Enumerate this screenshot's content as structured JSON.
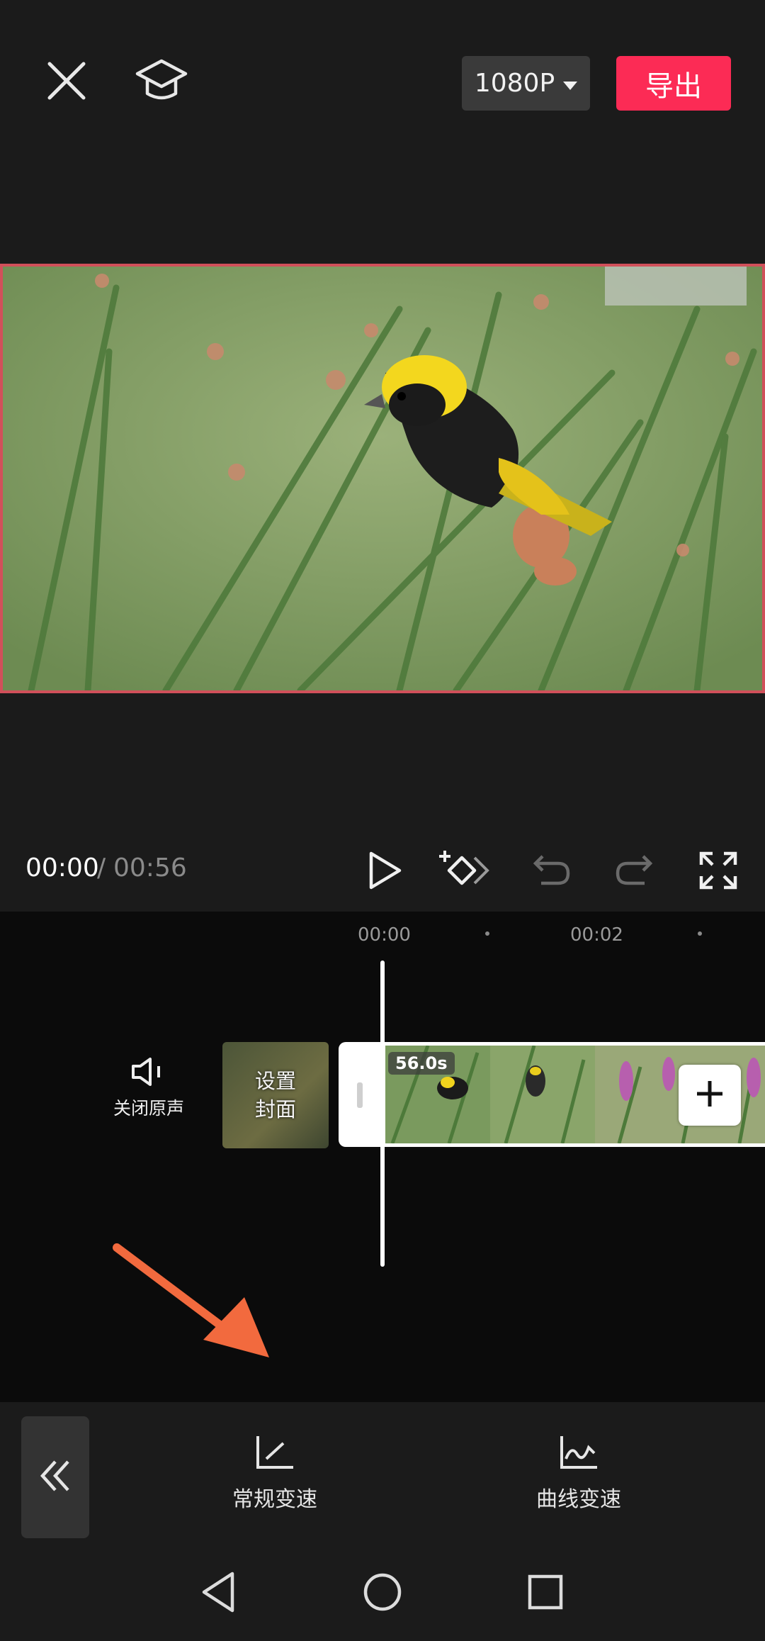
{
  "header": {
    "resolution_label": "1080P",
    "export_label": "导出"
  },
  "player": {
    "current_time": "00:00",
    "separator": "/",
    "total_time": "00:56"
  },
  "timeline": {
    "ticks": [
      "00:00",
      "00:02"
    ],
    "mute_label": "关闭原声",
    "cover_label_line1": "设置",
    "cover_label_line2": "封面",
    "clip_duration": "56.0s"
  },
  "toolbar": {
    "items": [
      {
        "label": "常规变速",
        "icon": "line-speed-icon"
      },
      {
        "label": "曲线变速",
        "icon": "curve-speed-icon"
      }
    ]
  },
  "colors": {
    "accent": "#fc2b55",
    "selection_border": "#d1505a",
    "annotation_arrow": "#f26a3e"
  }
}
